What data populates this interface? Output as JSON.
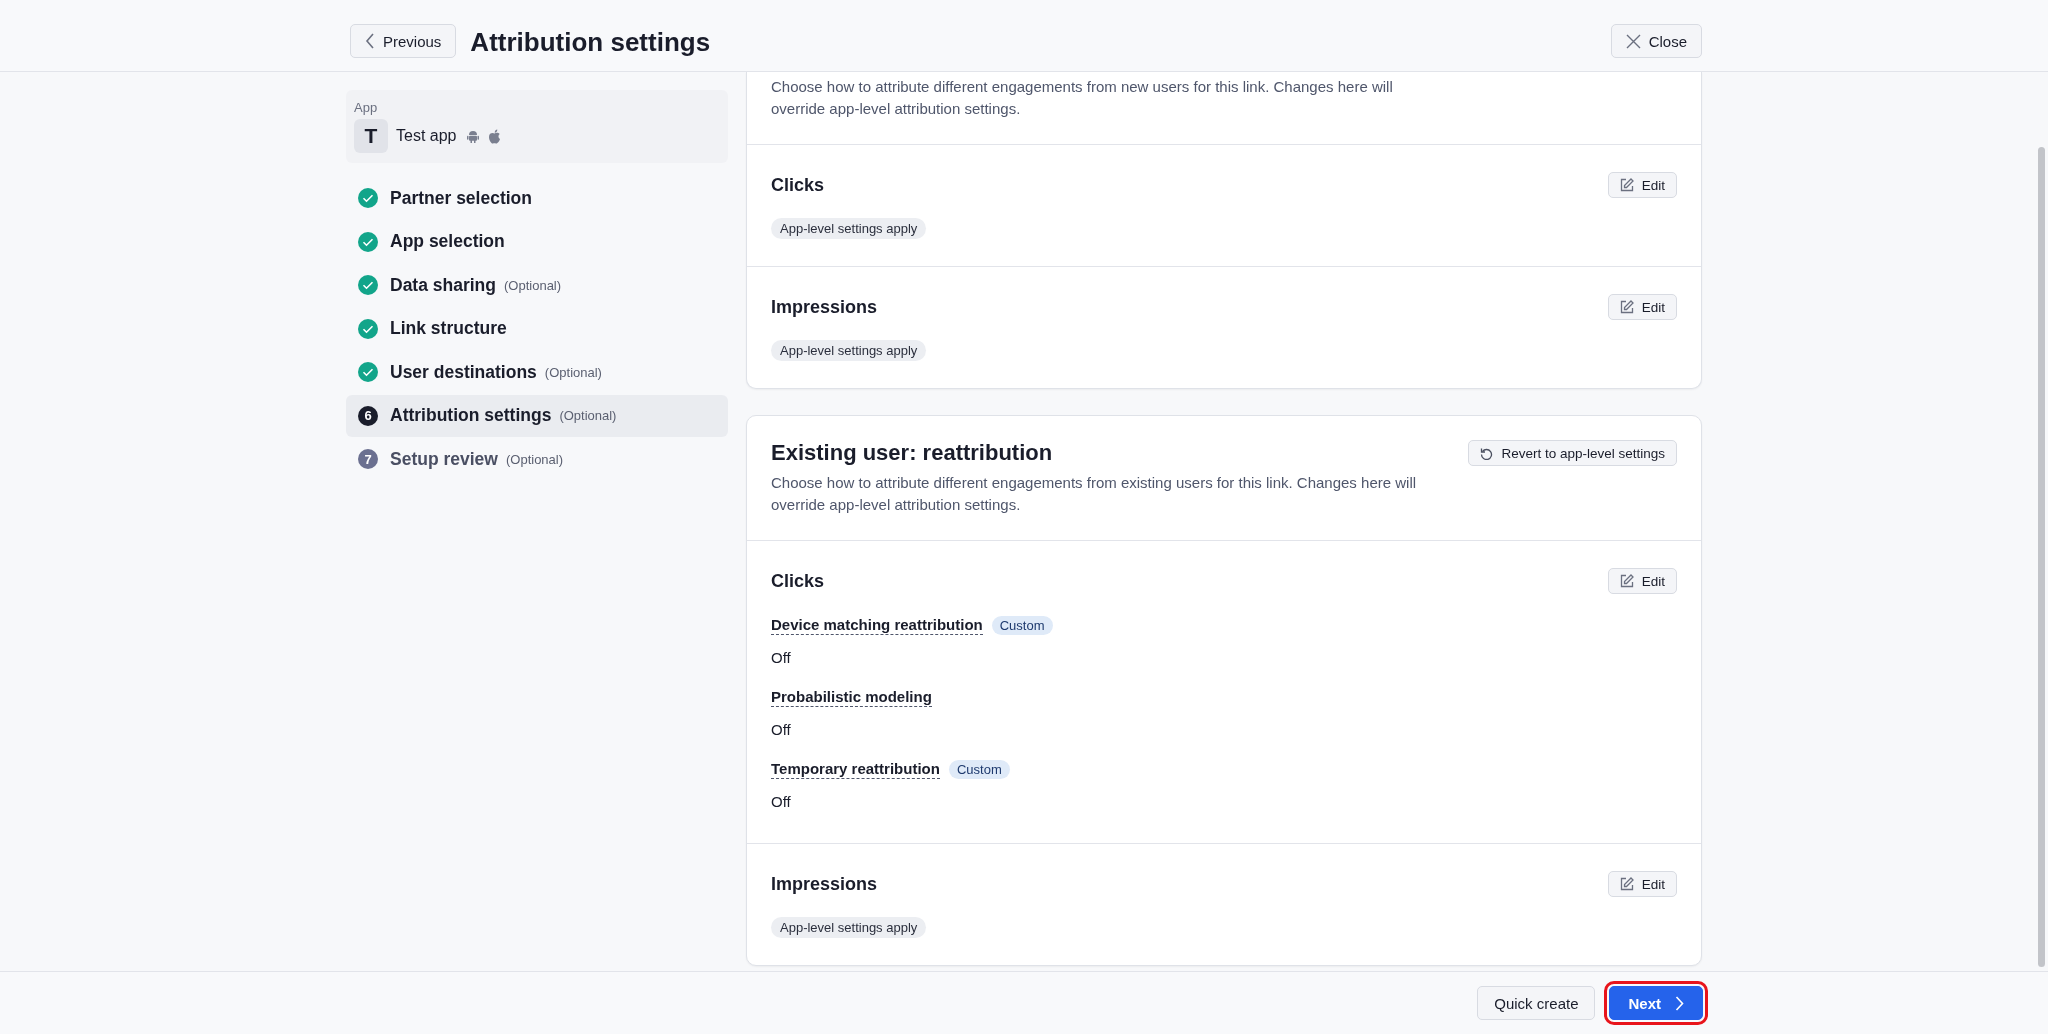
{
  "header": {
    "previous_button": "Previous",
    "title": "Attribution settings",
    "close_button": "Close"
  },
  "sidebar": {
    "app": {
      "label": "App",
      "avatar": "T",
      "name": "Test app"
    },
    "steps": [
      {
        "label": "Partner selection",
        "kind": "done",
        "selected": false
      },
      {
        "label": "App selection",
        "kind": "done",
        "selected": false
      },
      {
        "label": "Data sharing",
        "optional": "(Optional)",
        "kind": "done",
        "selected": false
      },
      {
        "label": "Link structure",
        "kind": "done",
        "selected": false
      },
      {
        "label": "User destinations",
        "optional": "(Optional)",
        "kind": "done",
        "selected": false
      },
      {
        "label": "Attribution settings",
        "optional": "(Optional)",
        "number": "6",
        "kind": "current",
        "selected": true
      },
      {
        "label": "Setup review",
        "optional": "(Optional)",
        "number": "7",
        "kind": "upcoming",
        "selected": false
      }
    ]
  },
  "sections": [
    {
      "description": "Choose how to attribute different engagements from new users for this link. Changes here will override app-level attribution settings.",
      "groups": [
        {
          "title": "Clicks",
          "edit_button": "Edit",
          "tag": "App-level settings apply"
        },
        {
          "title": "Impressions",
          "edit_button": "Edit",
          "tag": "App-level settings apply"
        }
      ]
    },
    {
      "title": "Existing user: reattribution",
      "revert_button": "Revert to app-level settings",
      "description": "Choose how to attribute different engagements from existing users for this link. Changes here will override app-level attribution settings.",
      "groups": [
        {
          "title": "Clicks",
          "edit_button": "Edit",
          "settings": [
            {
              "name": "Device matching reattribution",
              "badge": "Custom",
              "value": "Off"
            },
            {
              "name": "Probabilistic modeling",
              "value": "Off"
            },
            {
              "name": "Temporary reattribution",
              "badge": "Custom",
              "value": "Off"
            }
          ]
        },
        {
          "title": "Impressions",
          "edit_button": "Edit",
          "tag": "App-level settings apply"
        }
      ]
    }
  ],
  "footer": {
    "buttons": [
      {
        "label": "Quick create",
        "kind": "secondary",
        "highlighted": false
      },
      {
        "label": "Next",
        "kind": "primary",
        "highlighted": true
      }
    ]
  }
}
